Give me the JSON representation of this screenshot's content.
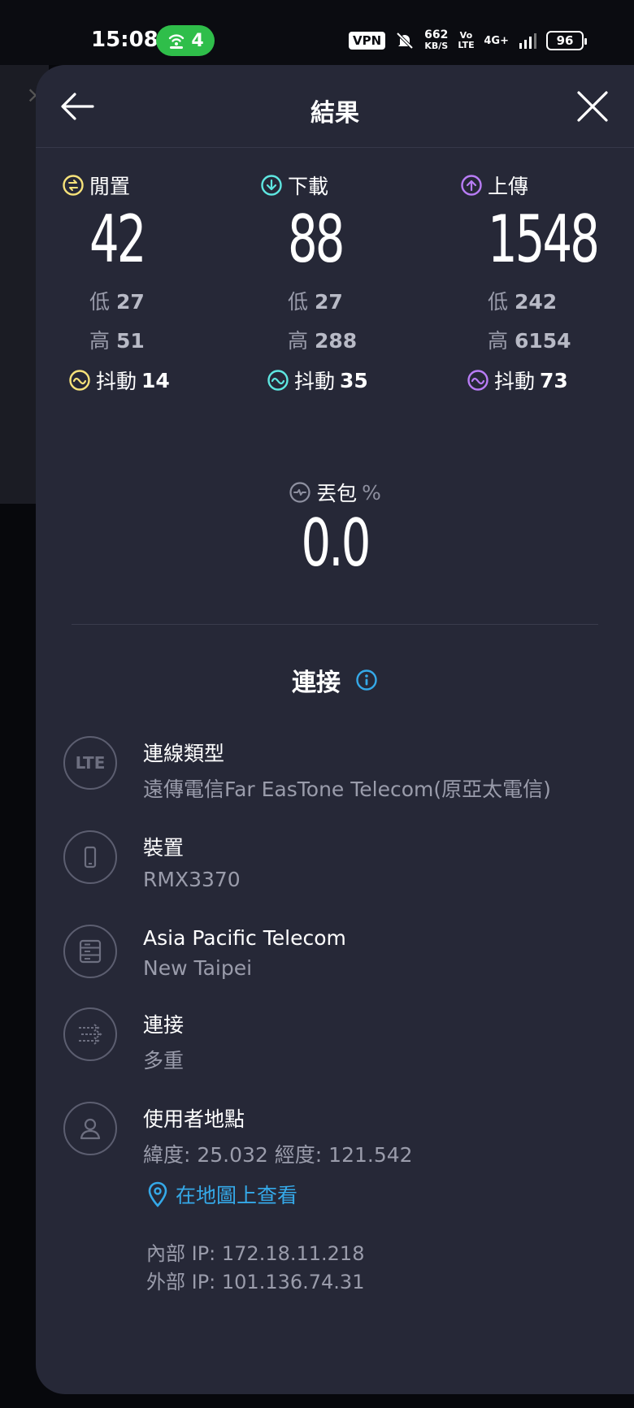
{
  "status_bar": {
    "time": "15:08",
    "hotspot_count": "4",
    "vpn": "VPN",
    "net_speed_value": "662",
    "net_speed_unit": "KB/S",
    "volte": "Vo LTE",
    "network": "4G+",
    "battery": "96"
  },
  "header": {
    "title": "結果"
  },
  "metrics": [
    {
      "label": "閒置",
      "value": "42",
      "low_label": "低",
      "low": "27",
      "high_label": "高",
      "high": "51",
      "jitter_label": "抖動",
      "jitter": "14",
      "color": "#f6e27a"
    },
    {
      "label": "下載",
      "value": "88",
      "low_label": "低",
      "low": "27",
      "high_label": "高",
      "high": "288",
      "jitter_label": "抖動",
      "jitter": "35",
      "color": "#5ee6e0"
    },
    {
      "label": "上傳",
      "value": "1548",
      "low_label": "低",
      "low": "242",
      "high_label": "高",
      "high": "6154",
      "jitter_label": "抖動",
      "jitter": "73",
      "color": "#b87cf5"
    }
  ],
  "packet_loss": {
    "label": "丟包",
    "unit": "%",
    "value": "0.0"
  },
  "connection": {
    "title": "連接",
    "items": [
      {
        "icon": "lte-icon",
        "icon_text": "LTE",
        "title": "連線類型",
        "subtitle": "遠傳電信Far EasTone Telecom(原亞太電信)"
      },
      {
        "icon": "phone-icon",
        "title": "裝置",
        "subtitle": "RMX3370"
      },
      {
        "icon": "server-icon",
        "title": "Asia Pacific Telecom",
        "subtitle": "New Taipei"
      },
      {
        "icon": "multi-connection-icon",
        "title": "連接",
        "subtitle": "多重"
      },
      {
        "icon": "user-icon",
        "title": "使用者地點",
        "subtitle": "緯度: 25.032 經度: 121.542"
      }
    ],
    "map_link": "在地圖上查看",
    "internal_ip": "內部 IP: 172.18.11.218",
    "external_ip": "外部 IP: 101.136.74.31"
  },
  "colors": {
    "panel": "#262837",
    "accent_link": "#35a9e8"
  }
}
